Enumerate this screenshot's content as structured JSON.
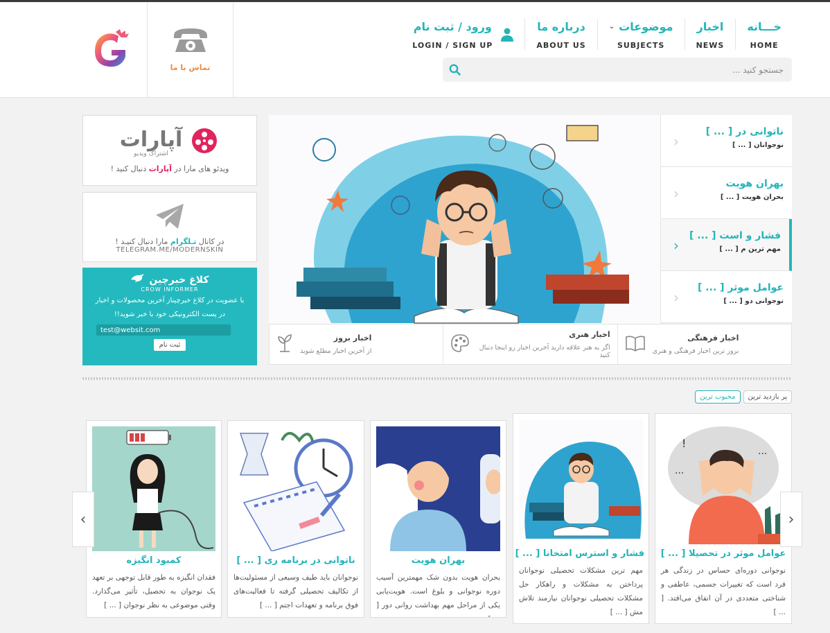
{
  "header": {
    "nav": [
      {
        "fa": "خـــانه",
        "en": "HOME"
      },
      {
        "fa": "اخبار",
        "en": "NEWS"
      },
      {
        "fa": "موضوعات",
        "en": "SUBJECTS"
      },
      {
        "fa": "درباره ما",
        "en": "ABOUT US"
      },
      {
        "fa": "ورود / ثبت نام",
        "en": "LOGIN / SIGN UP"
      }
    ],
    "search_placeholder": "جستجو کنید ...",
    "contact_label": "تماس با ما"
  },
  "widgets": {
    "aparat_brand": "آپارات",
    "aparat_sub": "اشتراک ویدیو",
    "aparat_caption_pre": "ویدئو های مارا در",
    "aparat_caption_link": "آپارات",
    "aparat_caption_post": "دنبال کنید !",
    "telegram_caption_pre": "در کانال",
    "telegram_caption_link": "تـلگرام",
    "telegram_caption_post": "مارا دنبال کنیـد !",
    "telegram_url": "TELEGRAM.ME/MODERNSKIN",
    "newsletter_brand": "کلاغ خبرچین",
    "newsletter_brand_en": "CROW INFORMER",
    "newsletter_text": "با عضویت در کلاغ خبرچیناز آخرین محصولات و اخبار در پست الکترونیکی خود با خبر شوید!!",
    "newsletter_email": "test@websit.com",
    "newsletter_button": "ثبت نام"
  },
  "slider": {
    "items": [
      {
        "title": "ناتوانی در [ ... ]",
        "sub": "نوجوانان [ ... ]"
      },
      {
        "title": "بهران هویت",
        "sub": "بحران هویت [ ... ]"
      },
      {
        "title": "فشار و است [ ... ]",
        "sub": "مهم ترین م [ ... ]"
      },
      {
        "title": "عوامل موثر [ ... ]",
        "sub": "نوجوانی دو [ ... ]"
      }
    ]
  },
  "features": [
    {
      "title": "اخبار فرهنگی",
      "desc": "بروز ترین اخبار فرهنگی و هنری",
      "icon": "book-icon"
    },
    {
      "title": "اخبار هنری",
      "desc": "اگر به هنر علاقه دارید آخرین اخبار رو اینجا دنبال کنید",
      "icon": "palette-icon"
    },
    {
      "title": "اخبار بروز",
      "desc": "از آخرین اخبار مطلع شوید",
      "icon": "sprout-icon"
    }
  ],
  "tabs": {
    "popular": "محبوب ترین",
    "most_viewed": "پر بازدید ترین"
  },
  "cards": [
    {
      "title": "عوامل موثر در تحصیلا [ ... ]",
      "text": "نوجوانی دوره‌ای حساس در زندگی هر فرد است که تغییرات جسمی، عاطفی و شناختی متعددی در آن اتفاق می‌افتد. [ ... ]"
    },
    {
      "title": "فشار و استرس امتحانا [ ... ]",
      "text": "مهم ترین مشکلات تحصیلی نوجوانان پرداختن به مشکلات و راهکار حل مشکلات تحصیلی نوجوانان نیازمند تلاش مش [ ... ]"
    },
    {
      "title": "بهران هویت",
      "text": "بحران هویت بدون شک مهمترین آسیب دوره نوجوانی و بلوغ است. هویت‌یابی یکی از مراحل مهم بهداشت روانی دور [ ... ]"
    },
    {
      "title": "ناتوانی در برنامه ری [ ... ]",
      "text": "نوجوانان باید طیف وسیعی از مسئولیت‌ها از تکالیف تحصیلی گرفته تا فعالیت‌های فوق برنامه و تعهدات اجتم [ ... ]"
    },
    {
      "title": "کمبود انگیزه",
      "text": "فقدان انگیزه به طور قابل توجهی بر تعهد یک نوجوان به تحصیل، تأثیر می‌گذارد. وقتی موضوعی به نظر نوجوان [ ... ]"
    }
  ],
  "colors": {
    "accent": "#23b5b8",
    "orange": "#f08a3c",
    "newsletter_bg": "#23b9be"
  }
}
